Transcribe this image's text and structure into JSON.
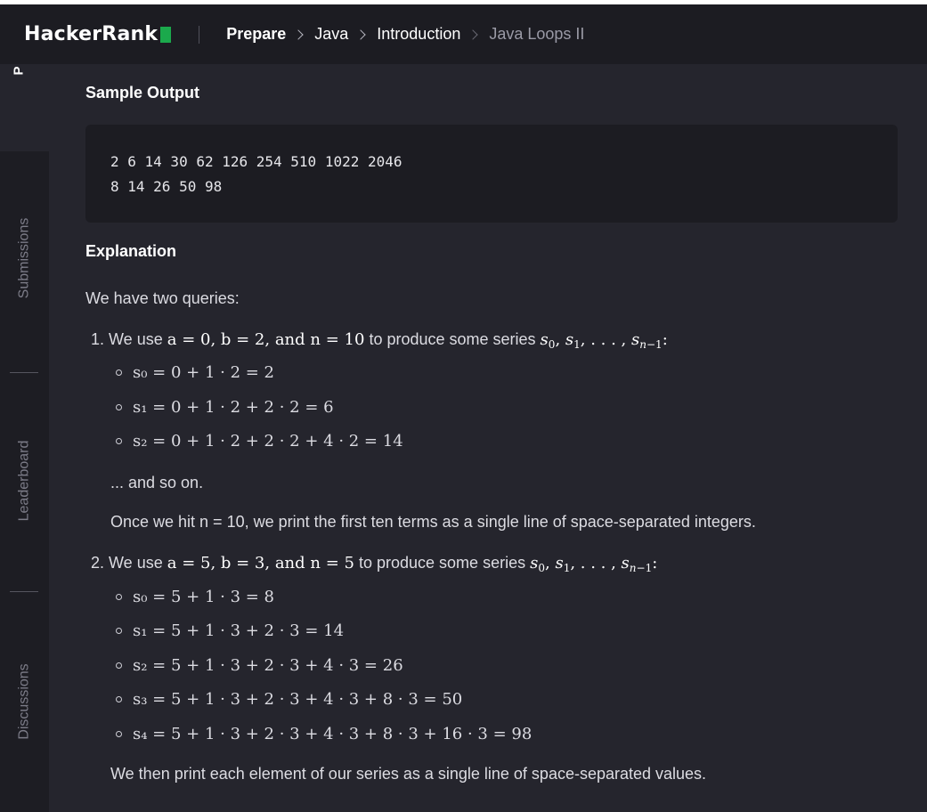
{
  "header": {
    "logo": "HackerRank",
    "breadcrumbs": [
      "Prepare",
      "Java",
      "Introduction",
      "Java Loops II"
    ]
  },
  "sidebar": {
    "tabs": [
      "Submissions",
      "Leaderboard",
      "Discussions"
    ],
    "top_fragment": "P"
  },
  "main": {
    "sample_output_heading": "Sample Output",
    "sample_output_lines": [
      "2 6 14 30 62 126 254 510 1022 2046",
      "8 14 26 50 98"
    ],
    "explanation_heading": "Explanation",
    "intro": "We have two queries:",
    "q1_prefix": "1. We use",
    "q1_suffix": "to produce some series",
    "q1_math_params": "a = 0, b = 2, and n = 10",
    "q1_items": [
      "s₀ = 0 + 1 · 2 = 2",
      "s₁ = 0 + 1 · 2 + 2 · 2 = 6",
      "s₂ = 0 + 1 · 2 + 2 · 2 + 4 · 2 = 14"
    ],
    "and_so_on": "... and so on.",
    "q1_conclusion": "Once we hit n = 10, we print the first ten terms as a single line of space-separated integers.",
    "q2_prefix": "2. We use",
    "q2_suffix": "to produce some series",
    "q2_math_params": "a = 5, b = 3, and n = 5",
    "q2_items": [
      "s₀ = 5 + 1 · 3 = 8",
      "s₁ = 5 + 1 · 3 + 2 · 3 = 14",
      "s₂ = 5 + 1 · 3 + 2 · 3 + 4 · 3 = 26",
      "s₃ = 5 + 1 · 3 + 2 · 3 + 4 · 3 + 8 · 3 = 50",
      "s₄ = 5 + 1 · 3 + 2 · 3 + 4 · 3 + 8 · 3 + 16 · 3 = 98"
    ],
    "q2_conclusion": "We then print each element of our series as a single line of space-separated values."
  }
}
